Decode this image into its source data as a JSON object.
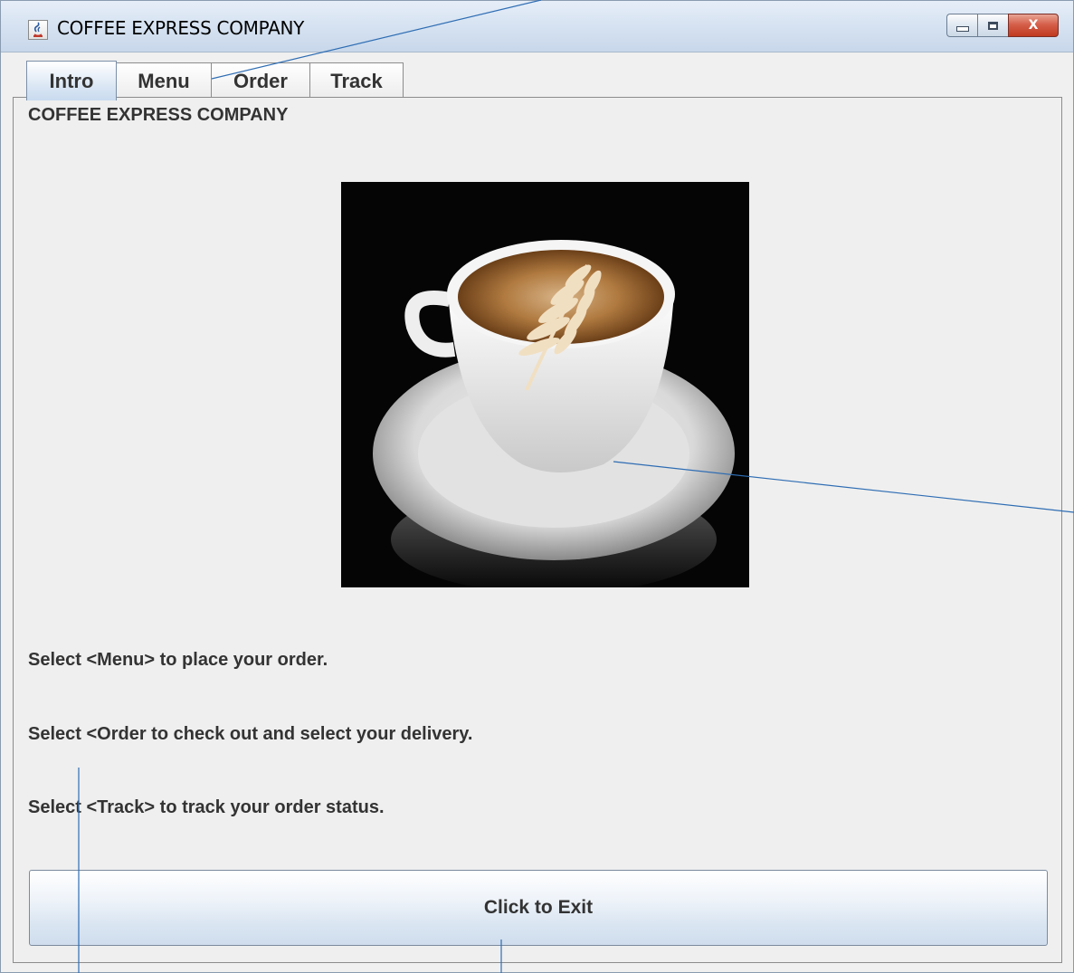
{
  "window": {
    "title": "COFFEE EXPRESS COMPANY",
    "controls": {
      "minimize_icon": "minimize-icon",
      "maximize_icon": "maximize-icon",
      "close_glyph": "X"
    }
  },
  "tabs": [
    {
      "label": "Intro",
      "selected": true
    },
    {
      "label": "Menu",
      "selected": false
    },
    {
      "label": "Order",
      "selected": false
    },
    {
      "label": "Track",
      "selected": false
    }
  ],
  "intro": {
    "heading": "COFFEE EXPRESS COMPANY",
    "image": "coffee-cup-latte-art",
    "instructions": [
      "Select <Menu> to place your order.",
      "Select <Order to check out and select your delivery.",
      "Select <Track> to track your order status."
    ],
    "exit_label": "Click to Exit"
  },
  "colors": {
    "titlebar": "#d3e0f0",
    "close_button": "#c0391f",
    "panel": "#efefef",
    "annotation_line": "#2e6db3"
  }
}
